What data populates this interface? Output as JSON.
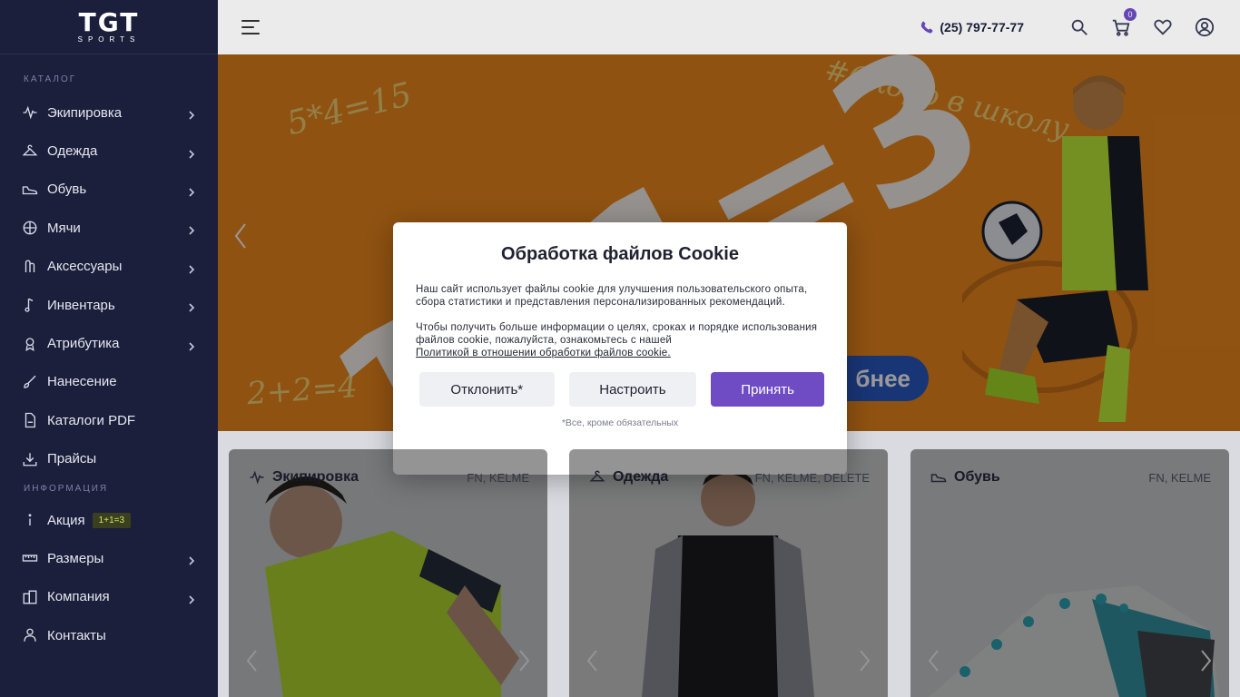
{
  "brand": {
    "logo_main": "TGT",
    "logo_sub": "SPORTS"
  },
  "sidebar": {
    "section_catalog": "КАТАЛОГ",
    "section_info": "ИНФОРМАЦИЯ",
    "catalog_items": [
      {
        "label": "Экипировка",
        "icon": "pulse-icon",
        "has_submenu": true
      },
      {
        "label": "Одежда",
        "icon": "hanger-icon",
        "has_submenu": true
      },
      {
        "label": "Обувь",
        "icon": "shoe-icon",
        "has_submenu": true
      },
      {
        "label": "Мячи",
        "icon": "ball-icon",
        "has_submenu": true
      },
      {
        "label": "Аксессуары",
        "icon": "accessories-icon",
        "has_submenu": true
      },
      {
        "label": "Инвентарь",
        "icon": "inventory-icon",
        "has_submenu": true
      },
      {
        "label": "Атрибутика",
        "icon": "medal-icon",
        "has_submenu": true
      },
      {
        "label": "Нанесение",
        "icon": "brush-icon",
        "has_submenu": false
      },
      {
        "label": "Каталоги PDF",
        "icon": "pdf-icon",
        "has_submenu": false
      },
      {
        "label": "Прайсы",
        "icon": "download-icon",
        "has_submenu": false
      }
    ],
    "info_items": [
      {
        "label": "Акция",
        "icon": "info-icon",
        "badge": "1+1=3",
        "has_submenu": false
      },
      {
        "label": "Размеры",
        "icon": "ruler-icon",
        "has_submenu": true
      },
      {
        "label": "Компания",
        "icon": "building-icon",
        "has_submenu": true
      },
      {
        "label": "Контакты",
        "icon": "contacts-icon",
        "has_submenu": false
      }
    ]
  },
  "header": {
    "phone": "(25) 797-77-77",
    "cart_count": "0"
  },
  "banner": {
    "formula": "1+1=3",
    "chalk_1": "5*4=15",
    "chalk_2": "#Скоро в школу",
    "chalk_3": "2+2=4",
    "button_visible": "бнее"
  },
  "cards": [
    {
      "title": "Экипировка",
      "brands": "FN, KELME",
      "icon": "pulse-icon"
    },
    {
      "title": "Одежда",
      "brands": "FN, KELME, DELETE",
      "icon": "hanger-icon"
    },
    {
      "title": "Обувь",
      "brands": "FN, KELME",
      "icon": "shoe-icon"
    }
  ],
  "cookie_modal": {
    "title": "Обработка файлов Cookie",
    "paragraph_1": "Наш сайт использует файлы cookie для улучшения пользовательского опыта, сбора статистики и представления персонализированных рекомендаций.",
    "paragraph_2": "Чтобы получить больше информации о целях, сроках и порядке использования файлов cookie, пожалуйста, ознакомьтесь с нашей",
    "policy_link": "Политикой в отношении обработки файлов cookie.",
    "decline_label": "Отклонить*",
    "settings_label": "Настроить",
    "accept_label": "Принять",
    "footnote": "*Все, кроме обязательных"
  },
  "colors": {
    "sidebar_bg": "#1b1f3c",
    "accent": "#6f4cc4",
    "banner_orange": "#f08a1e",
    "banner_button": "#2a5ac6"
  }
}
